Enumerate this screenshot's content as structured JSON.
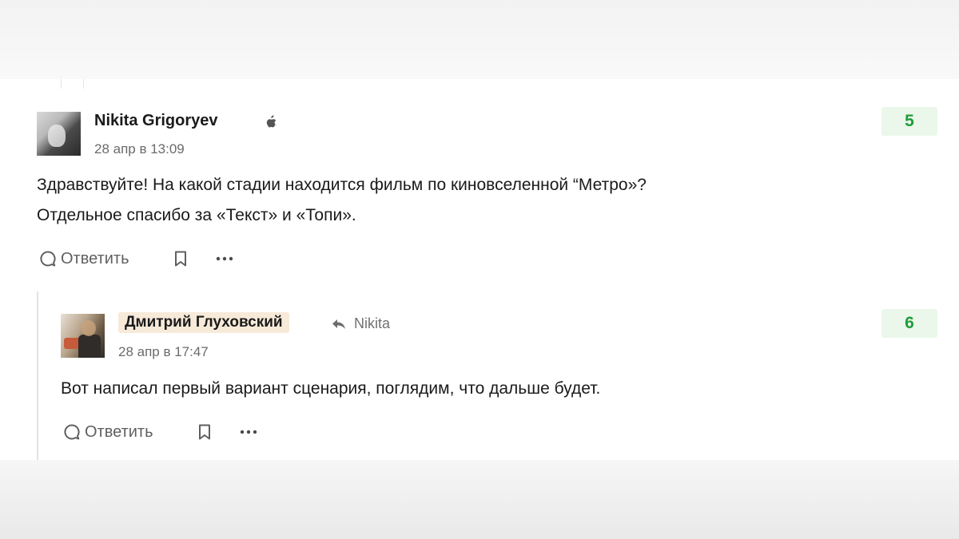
{
  "comments": [
    {
      "author": "Nikita Grigoryev",
      "platform_icon": "apple-icon",
      "date": "28 апр в 13:09",
      "text_lines": [
        "Здравствуйте! На какой стадии находится фильм по киновселенной “Метро»?",
        "Отдельное спасибо за «Текст» и «Топи»."
      ],
      "score": "5",
      "actions": {
        "reply_label": "Ответить"
      }
    },
    {
      "author": "Дмитрий Глуховский",
      "reply_to": "Nikita",
      "date": "28 апр в 17:47",
      "text_lines": [
        "Вот написал первый вариант сценария, поглядим, что дальше будет."
      ],
      "score": "6",
      "actions": {
        "reply_label": "Ответить"
      }
    }
  ],
  "colors": {
    "score_text": "#1f9d3a",
    "score_bg": "#eaf7ea",
    "author_badge_bg": "#f7ead9",
    "muted_text": "#6b6b6b"
  }
}
